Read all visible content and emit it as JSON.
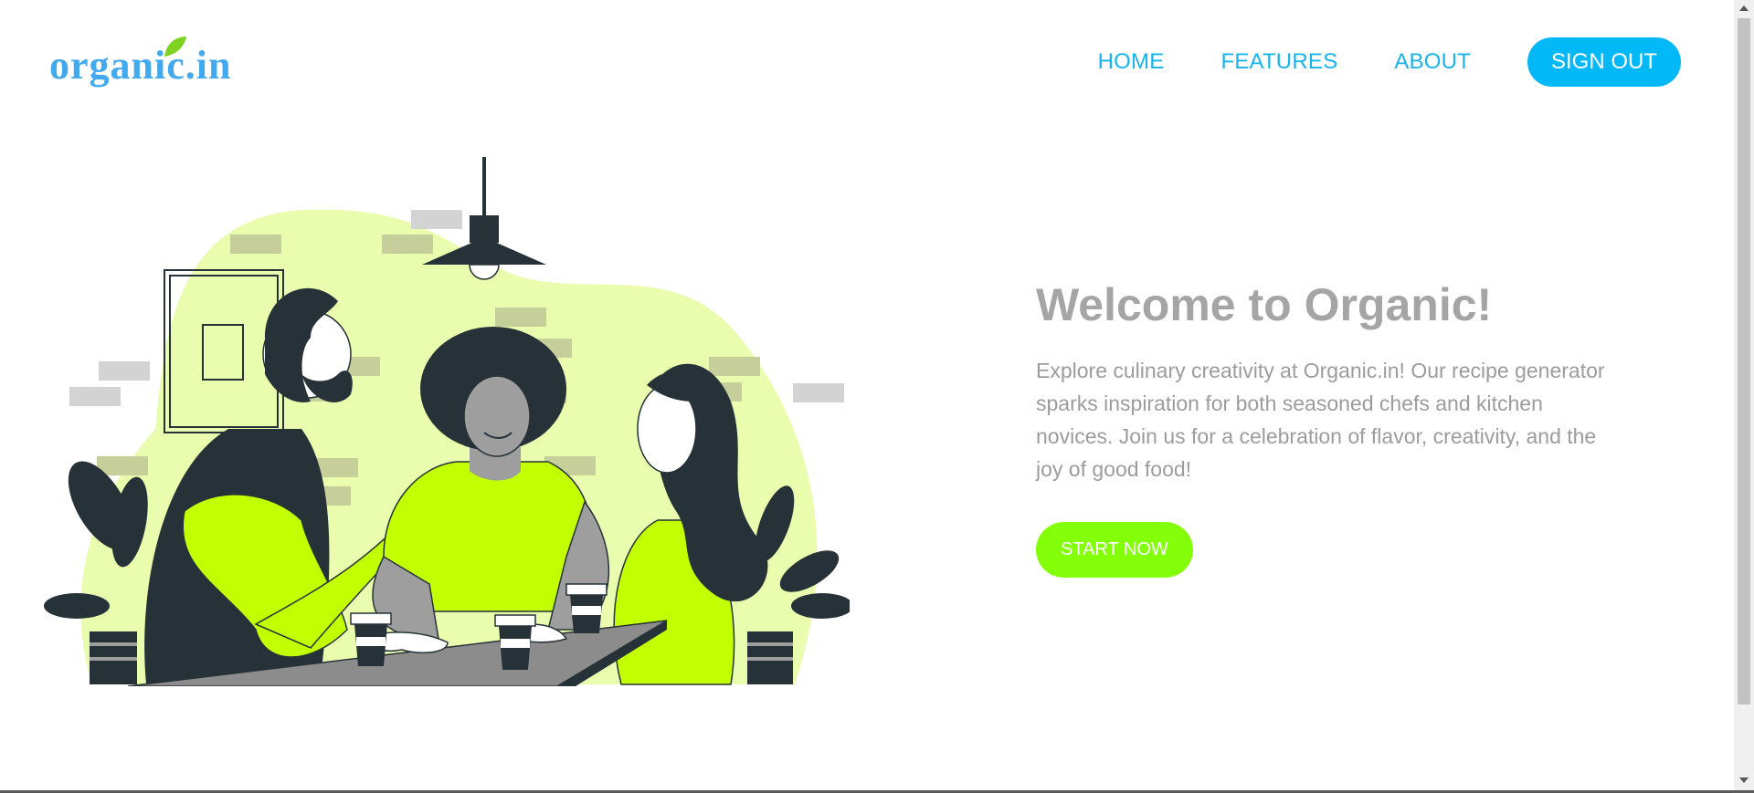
{
  "brand": {
    "logo_text": "organic.in",
    "color": "#42a9ef",
    "leaf_color": "#7ed321"
  },
  "nav": {
    "links": [
      {
        "label": "HOME"
      },
      {
        "label": "FEATURES"
      },
      {
        "label": "ABOUT"
      }
    ],
    "sign_out_label": "SIGN OUT",
    "link_color": "#18b3ec",
    "button_color": "#03b8f7"
  },
  "hero": {
    "title": "Welcome to Organic!",
    "description": "Explore culinary creativity at Organic.in! Our recipe generator sparks inspiration for both seasoned chefs and kitchen novices. Join us for a celebration of flavor, creativity, and the joy of good food!",
    "cta_label": "START NOW",
    "cta_color": "#84ff0a",
    "illustration": {
      "icon": "friends-at-cafe-illustration",
      "accent_color": "#c2ff00",
      "background_blob_color": "#eafcae",
      "dark_color": "#263238"
    }
  }
}
